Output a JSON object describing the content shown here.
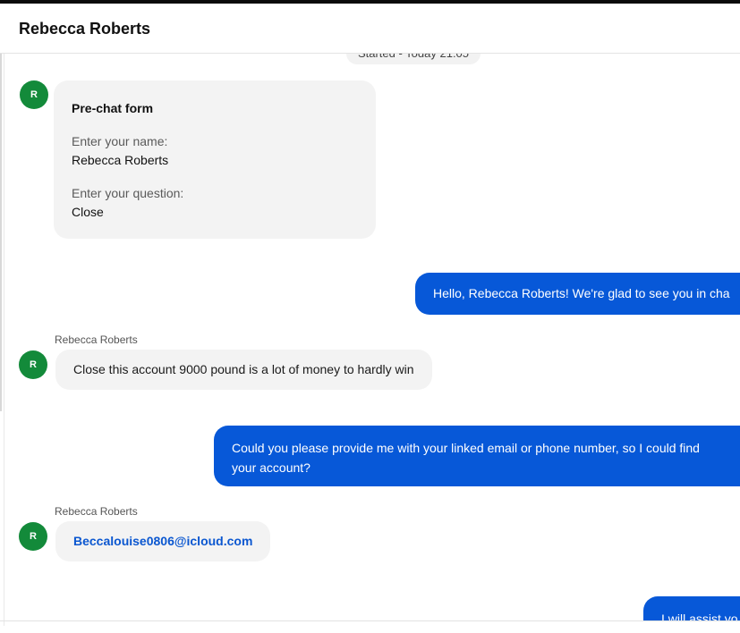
{
  "header": {
    "title": "Rebecca Roberts"
  },
  "chat": {
    "started_label": "Started - Today 21:05",
    "prechat": {
      "avatar_initial": "R",
      "title": "Pre-chat form",
      "name_label": "Enter your name:",
      "name_value": "Rebecca Roberts",
      "question_label": "Enter your question:",
      "question_value": "Close"
    },
    "messages": [
      {
        "direction": "out",
        "text": "Hello, Rebecca Roberts! We're glad to see you in cha"
      },
      {
        "direction": "in",
        "sender": "Rebecca Roberts",
        "avatar_initial": "R",
        "text": "Close this account 9000 pound is a lot of money to hardly win"
      },
      {
        "direction": "out",
        "line1": "Could you please provide me with your linked email or phone number, so I could find",
        "line2": "your account?"
      },
      {
        "direction": "in",
        "sender": "Rebecca Roberts",
        "avatar_initial": "R",
        "text": "Beccalouise0806@icloud.com"
      },
      {
        "direction": "out",
        "text": "I will assist yo"
      }
    ]
  },
  "colors": {
    "agent_bubble": "#0758d8",
    "customer_bubble": "#f3f3f3",
    "avatar": "#138a3a",
    "email_link": "#0b57d0"
  }
}
